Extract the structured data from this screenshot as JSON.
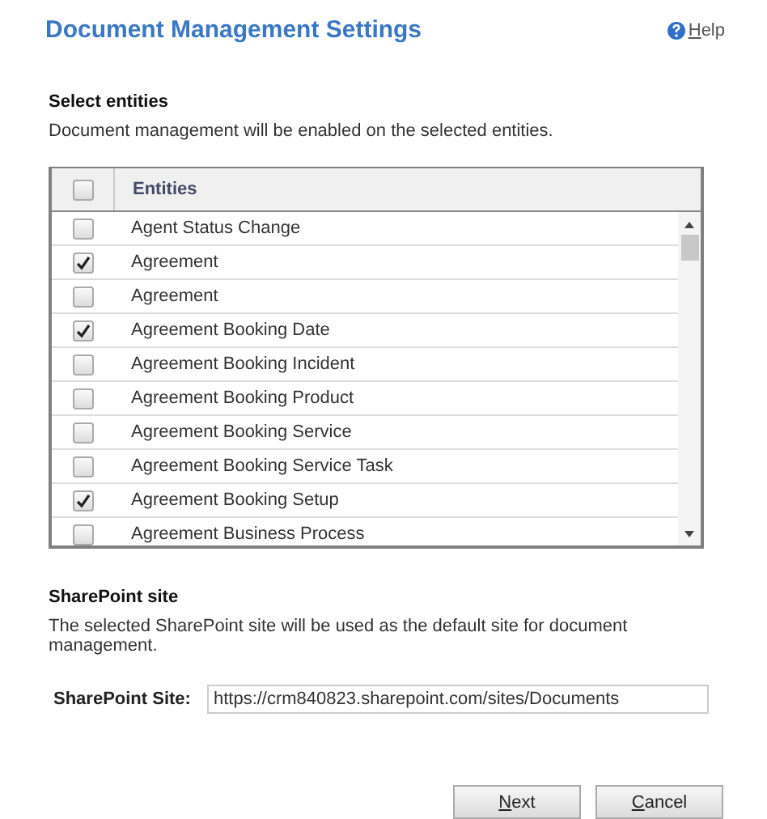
{
  "title": "Document Management Settings",
  "help": "Help",
  "entities_section": {
    "heading": "Select entities",
    "description": "Document management will be enabled on the selected entities."
  },
  "table": {
    "header_checked": false,
    "column": "Entities",
    "rows": [
      {
        "name": "Agent Status Change",
        "checked": false
      },
      {
        "name": "Agreement",
        "checked": true
      },
      {
        "name": "Agreement",
        "checked": false
      },
      {
        "name": "Agreement Booking Date",
        "checked": true
      },
      {
        "name": "Agreement Booking Incident",
        "checked": false
      },
      {
        "name": "Agreement Booking Product",
        "checked": false
      },
      {
        "name": "Agreement Booking Service",
        "checked": false
      },
      {
        "name": "Agreement Booking Service Task",
        "checked": false
      },
      {
        "name": "Agreement Booking Setup",
        "checked": true
      },
      {
        "name": "Agreement Business Process",
        "checked": false
      }
    ]
  },
  "sharepoint_section": {
    "heading": "SharePoint site",
    "description": "The selected SharePoint site will be used as the default site for document management.",
    "field_label": "SharePoint Site:",
    "field_value": "https://crm840823.sharepoint.com/sites/Documents"
  },
  "buttons": [
    "Next",
    "Cancel"
  ]
}
